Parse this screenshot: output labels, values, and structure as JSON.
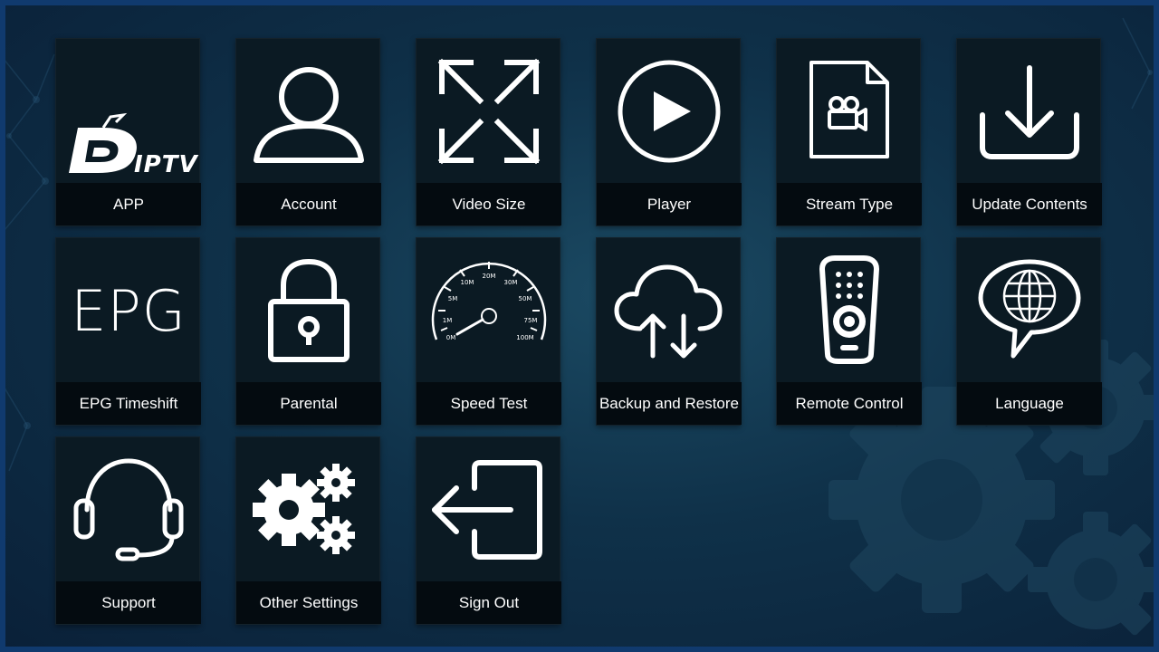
{
  "theme": {
    "accent": "#103a6e",
    "tile_bg": "#0b1a23",
    "label_bg": "#040b10",
    "icon_color": "#ffffff"
  },
  "app": {
    "logo_text": "IPTV"
  },
  "epg": {
    "icon_text": "EPG"
  },
  "speedometer": {
    "scale": [
      "0M",
      "1M",
      "5M",
      "10M",
      "20M",
      "30M",
      "50M",
      "75M",
      "100M"
    ]
  },
  "tiles": [
    {
      "label": "APP",
      "icon": "duplex-iptv-logo"
    },
    {
      "label": "Account",
      "icon": "user-icon"
    },
    {
      "label": "Video Size",
      "icon": "expand-arrows-icon"
    },
    {
      "label": "Player",
      "icon": "play-circle-icon"
    },
    {
      "label": "Stream Type",
      "icon": "video-file-icon"
    },
    {
      "label": "Update Contents",
      "icon": "download-icon"
    },
    {
      "label": "EPG Timeshift",
      "icon": "epg-text-icon"
    },
    {
      "label": "Parental",
      "icon": "padlock-icon"
    },
    {
      "label": "Speed Test",
      "icon": "speedometer-icon"
    },
    {
      "label": "Backup and Restore",
      "icon": "cloud-sync-icon"
    },
    {
      "label": "Remote Control",
      "icon": "remote-control-icon"
    },
    {
      "label": "Language",
      "icon": "globe-speech-icon"
    },
    {
      "label": "Support",
      "icon": "headset-icon"
    },
    {
      "label": "Other Settings",
      "icon": "gears-icon"
    },
    {
      "label": "Sign Out",
      "icon": "sign-out-icon"
    }
  ]
}
